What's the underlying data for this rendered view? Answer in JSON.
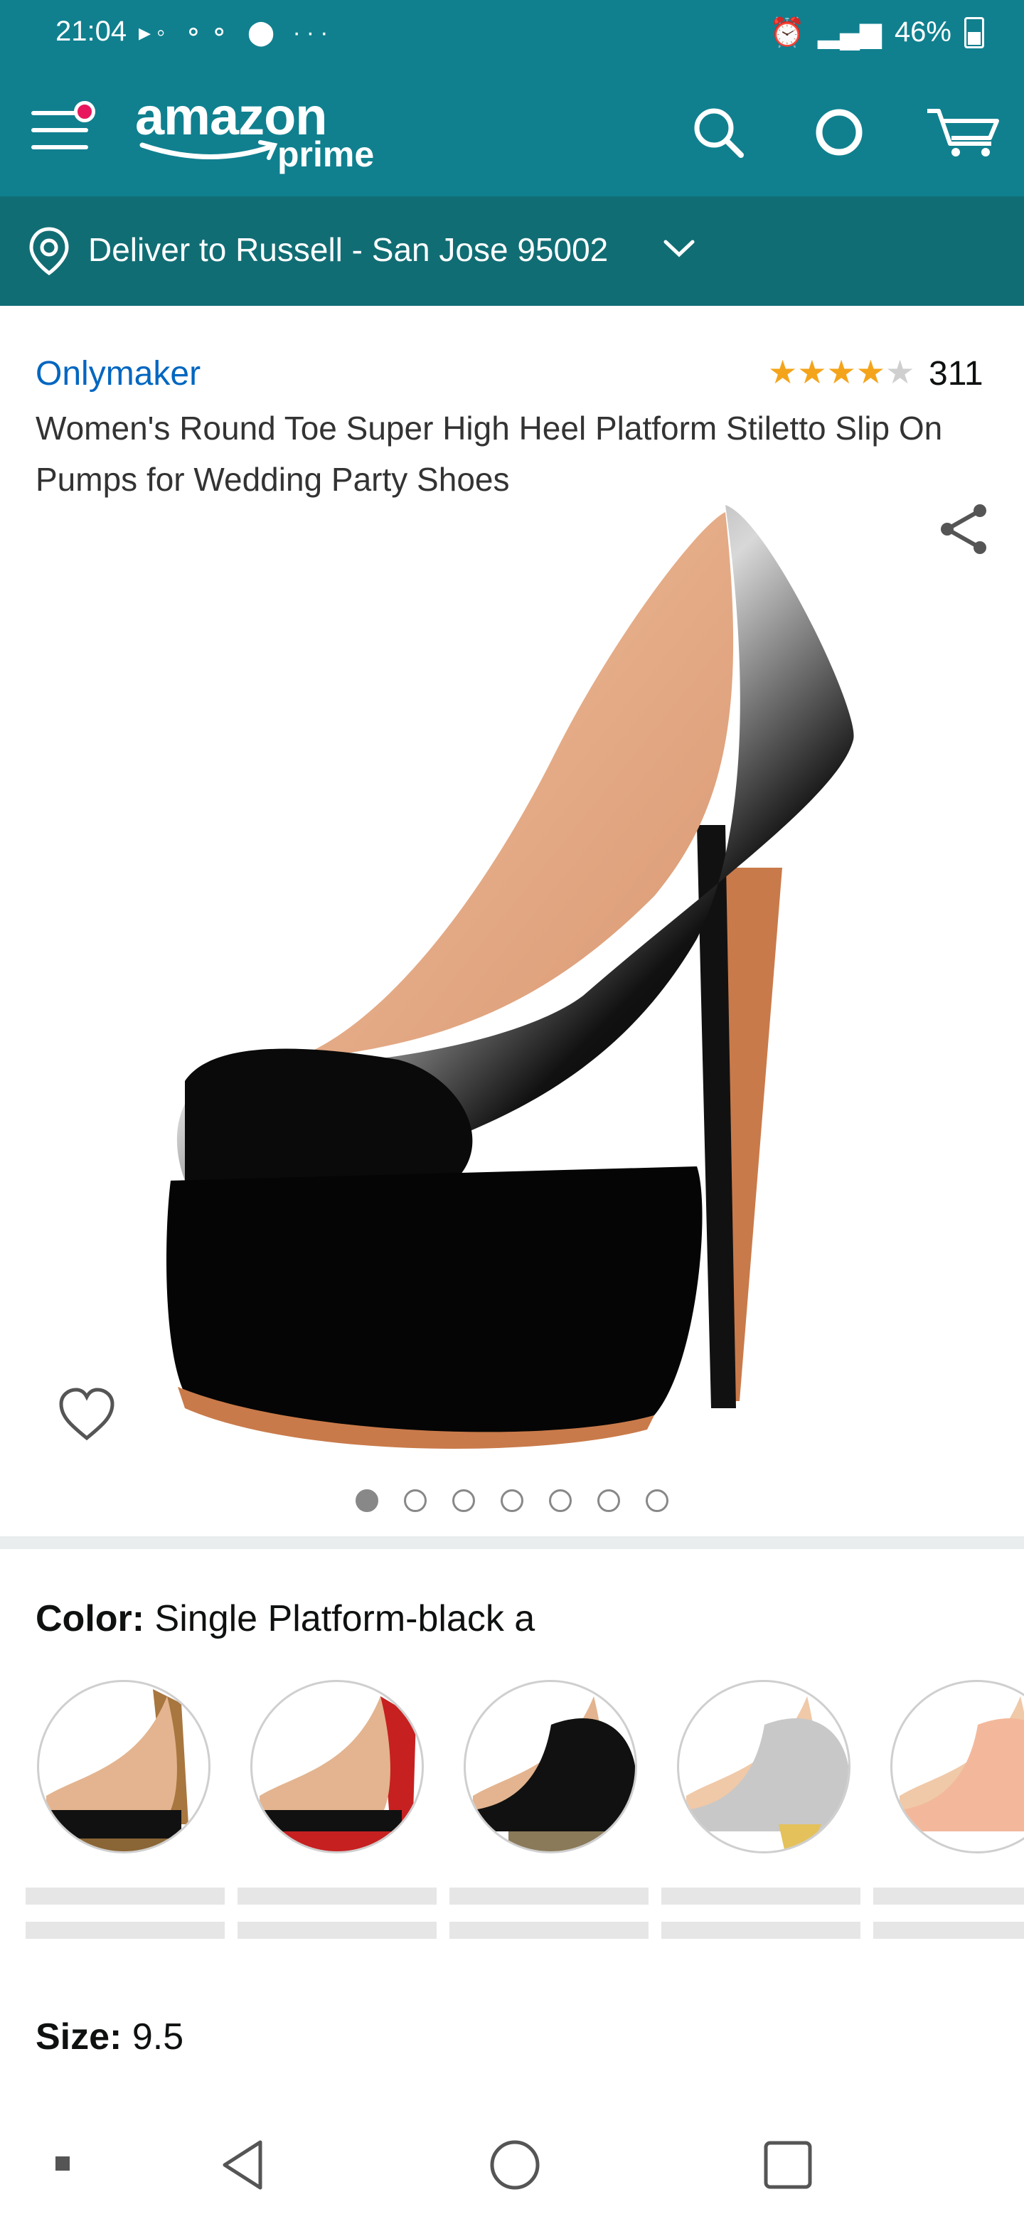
{
  "status_bar": {
    "time": "21:04",
    "battery": "46%"
  },
  "header": {
    "logo_text": "amazon",
    "logo_sub": "prime",
    "icons": [
      "menu-icon",
      "search-icon",
      "alexa-icon",
      "cart-icon"
    ]
  },
  "delivery": {
    "label": "Deliver to Russell - San Jose 95002"
  },
  "product": {
    "brand": "Onlymaker",
    "rating": 4,
    "rating_max": 5,
    "review_count": "311",
    "title": "Women's Round Toe Super High Heel Platform Stiletto Slip On Pumps for Wedding Party Shoes",
    "image_index": 1,
    "image_count": 7
  },
  "color": {
    "label": "Color:",
    "value": "Single Platform-black a",
    "swatches": [
      "black-leopard",
      "black-red",
      "black-glitter",
      "silver-gold",
      "nude"
    ]
  },
  "size": {
    "label": "Size:",
    "value": "9.5"
  },
  "colors": {
    "header_bg": "#10808f",
    "deliver_bg": "#116d74",
    "link": "#0066c0",
    "star": "#f4a41b"
  }
}
